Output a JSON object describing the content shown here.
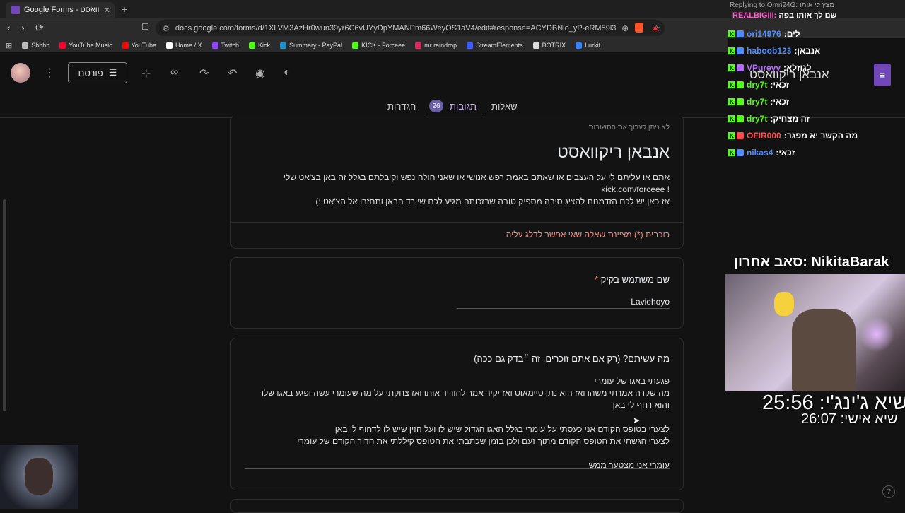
{
  "browser": {
    "tab_title": "Google Forms - אנבאן ריקוואסט",
    "tab_close": "✕",
    "new_tab": "+",
    "url": "docs.google.com/forms/d/1XLVM3AzHr0wun39yr6C6vUYyDpYMANPm66WeyOS1aV4/edit#response=ACYDBNio_yP-eRM59l3YEmVzaoEE...",
    "bookmarks": [
      {
        "label": "Shhhh",
        "icon": "folder-icon",
        "color": "#bbbbbb"
      },
      {
        "label": "YouTube Music",
        "icon": "youtube-music-icon",
        "color": "#ff0033"
      },
      {
        "label": "YouTube",
        "icon": "youtube-icon",
        "color": "#ff0000"
      },
      {
        "label": "Home / X",
        "icon": "x-icon",
        "color": "#ffffff"
      },
      {
        "label": "Twitch",
        "icon": "twitch-icon",
        "color": "#9146ff"
      },
      {
        "label": "Kick",
        "icon": "kick-icon",
        "color": "#53fc18"
      },
      {
        "label": "Summary - PayPal",
        "icon": "paypal-icon",
        "color": "#2790c3"
      },
      {
        "label": "KICK - Forceee",
        "icon": "kick-icon",
        "color": "#53fc18"
      },
      {
        "label": "mr raindrop",
        "icon": "raindrop-icon",
        "color": "#e0245e"
      },
      {
        "label": "StreamElements",
        "icon": "streamelements-icon",
        "color": "#3d5afe"
      },
      {
        "label": "BOTRIX",
        "icon": "botrix-icon",
        "color": "#dddddd"
      },
      {
        "label": "Lurkit",
        "icon": "lurkit-icon",
        "color": "#3b82f6"
      }
    ]
  },
  "forms": {
    "publish_label": "פורסם",
    "title": "אנבאן ריקוואסט",
    "tabs": {
      "questions": "שאלות",
      "responses": "תגובות",
      "settings": "הגדרות"
    },
    "response_count": "26",
    "colors": {
      "accent": "#a58fe0",
      "brand": "#7248b9",
      "required": "#f28b82"
    }
  },
  "response": {
    "no_edit_notice": "לא ניתן לערוך את התשובות",
    "form_title": "אנבאן ריקוואסט",
    "description": [
      "אתם או עליתם לי על העצבים או שאתם באמת רפש אנושי או שאני חולה נפש וקיבלתם בגלל זה באן בצ'אט שלי",
      "kick.com/forceee !",
      "אז כאן יש לכם הזדמנות להציג סיבה מספיק טובה שבזכותה מגיע לכם שיירד הבאן ותחזרו אל הצ'אט :)"
    ],
    "required_notice": "כוכבית (*) מציינת שאלה שאי אפשר לדלג עליה",
    "q1_label": "שם משתמש בקיק",
    "q1_star": "*",
    "q1_answer": "Laviehoyo",
    "q2_label": "מה עשיתם? (רק אם אתם זוכרים, זה ״בדק גם ככה)",
    "q2_answer_paragraphs": [
      [
        "פגעתי באגו של עומרי",
        "מה שקרה אמרתי משהו ואז הוא נתן טיימאוט ואז יקיר אמר להוריד אותו ואז צחקתי על מה שעומרי עשה ופגע באגו שלו והוא דחף לי באן"
      ],
      [
        "לצערי בטופס הקודם אני כעסתי על עומרי בגלל האגו הגדול שיש לו ועל הזין שיש לו לדחוף לי באן",
        "לצערי הגשתי את הטופס הקודם מתוך זעם ולכן בזמן שכתבתי את הטופס קיללתי את הדור הקודם של עומרי"
      ],
      [
        "עומרי אני מצטער ממש"
      ]
    ]
  },
  "chat": {
    "replying_to": "Replying to Omri24G: מצץ לי אותו",
    "pinned_user": "REALBIGIII:",
    "pinned_text": "שם לך אותו בפה",
    "messages": [
      {
        "user": "ori14976",
        "text": "לים",
        "color": "#4f8cff"
      },
      {
        "user": "haboob123",
        "text": "אנבאן",
        "color": "#4f8cff"
      },
      {
        "user": "VPureyy",
        "text": "לגוזלא",
        "color": "#b46bff"
      },
      {
        "user": "dry7t",
        "text": "זכאי",
        "color": "#53fc18"
      },
      {
        "user": "dry7t",
        "text": "זכאי",
        "color": "#53fc18"
      },
      {
        "user": "dry7t",
        "text": "זה מצחיק",
        "color": "#53fc18"
      },
      {
        "user": "OFIR000",
        "text": "מה הקשר יא מפגר",
        "color": "#ff4d4d"
      },
      {
        "user": "nikas4",
        "text": "זכאי",
        "color": "#4f8cff"
      }
    ],
    "separator": ":"
  },
  "stream": {
    "last_sub": "סאב אחרון: NikitaBarak",
    "timer_global": "שיא ג'ינג'י: 25:56",
    "timer_personal": "שיא אישי: 26:07"
  }
}
